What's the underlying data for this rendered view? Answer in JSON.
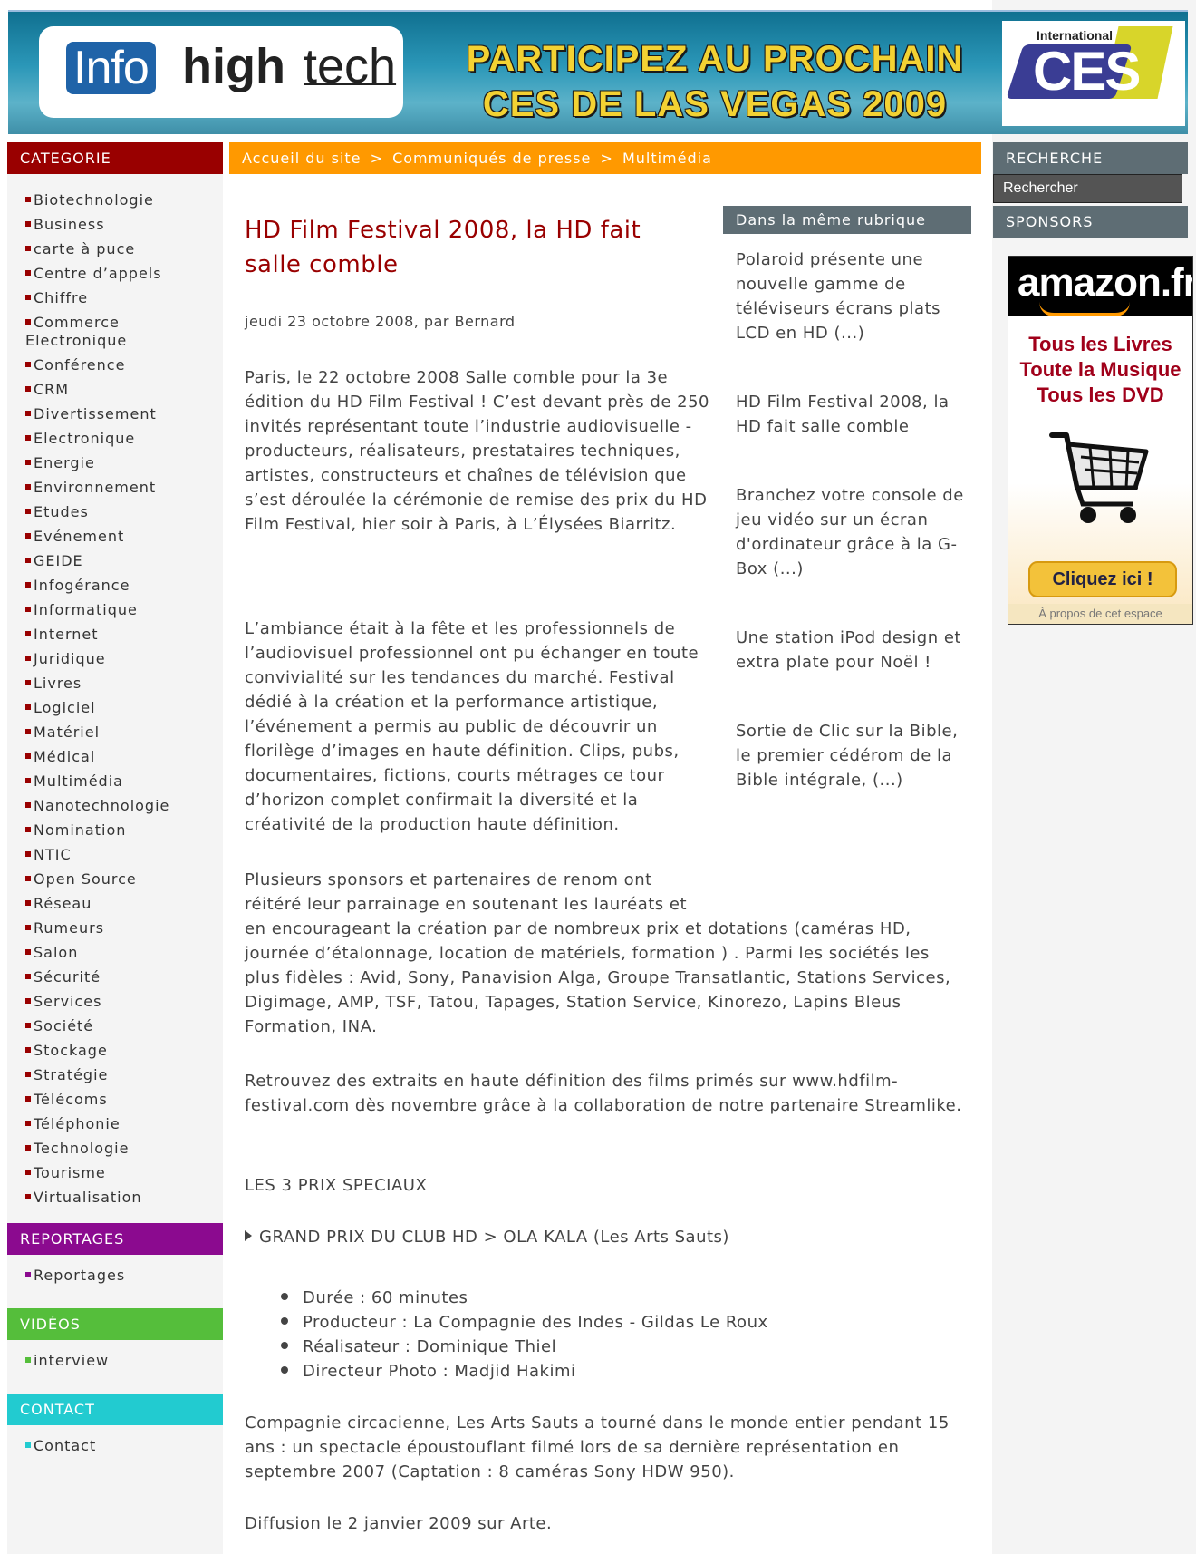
{
  "banner": {
    "logo_info": "Info",
    "logo_high": "high",
    "logo_tech": "tech",
    "promo_line1": "PARTICIPEZ AU PROCHAIN",
    "promo_line2": "CES DE LAS VEGAS 2009",
    "ces_international": "International",
    "ces_logo": "CES"
  },
  "sidebar_left": {
    "categorie_title": "CATEGORIE",
    "categories": [
      "Biotechnologie",
      "Business",
      "carte à puce",
      "Centre d’appels",
      "Chiffre",
      "Commerce Electronique",
      "Conférence",
      "CRM",
      "Divertissement",
      "Electronique",
      "Energie",
      "Environnement",
      "Etudes",
      "Evénement",
      "GEIDE",
      "Infogérance",
      "Informatique",
      "Internet",
      "Juridique",
      "Livres",
      "Logiciel",
      "Matériel",
      "Médical",
      "Multimédia",
      "Nanotechnologie",
      "Nomination",
      "NTIC",
      "Open Source",
      "Réseau",
      "Rumeurs",
      "Salon",
      "Sécurité",
      "Services",
      "Société",
      "Stockage",
      "Stratégie",
      "Télécoms",
      "Téléphonie",
      "Technologie",
      "Tourisme",
      "Virtualisation"
    ],
    "reportages_title": "REPORTAGES",
    "reportages_item": "Reportages",
    "videos_title": "VIDÉOS",
    "videos_item": "interview",
    "contact_title": "CONTACT",
    "contact_item": "Contact"
  },
  "breadcrumb": {
    "home": "Accueil du site",
    "section": "Communiqués de presse",
    "subsection": "Multimédia",
    "separator": ">"
  },
  "article": {
    "title": "HD Film Festival 2008, la HD fait salle comble",
    "byline": "jeudi 23 octobre 2008, par Bernard",
    "p1": "Paris, le 22 octobre 2008 Salle comble pour la 3e édition du HD Film Festival ! C’est devant près de 250 invités représentant toute l’industrie audiovisuelle - producteurs, réalisateurs, prestataires techniques, artistes, constructeurs et chaînes de télévision que s’est déroulée la cérémonie de remise des prix du HD Film Festival, hier soir à Paris, à L’Élysées Biarritz.",
    "p2": "L’ambiance était à la fête et les professionnels de l’audiovisuel professionnel ont pu échanger en toute convivialité sur les tendances du marché. Festival dédié à la création et la performance artistique, l’événement a permis au public de découvrir un florilège d’images en haute définition. Clips, pubs, documentaires, fictions, courts métrages ce tour d’horizon complet confirmait la diversité et la créativité de la production haute définition.",
    "p3_start": "Plusieurs sponsors et partenaires de renom ont réitéré leur parrainage en soutenant les lauréats et",
    "p3_end": "en encourageant la création par de nombreux prix et dotations (caméras HD, journée d’étalonnage, location de matériels, formation ) . Parmi les sociétés les plus fidèles : Avid, Sony, Panavision Alga, Groupe Transatlantic, Stations Services, Digimage, AMP, TSF, Tatou, Tapages, Station Service, Kinorezo, Lapins Bleus Formation, INA.",
    "p4": "Retrouvez des extraits en haute définition des films primés sur www.hdfilm-festival.com dès novembre grâce à la collaboration de notre partenaire Streamlike.",
    "p5": "LES 3 PRIX SPECIAUX",
    "prize": "GRAND PRIX DU CLUB HD > OLA KALA (Les Arts Sauts)",
    "details": [
      "Durée : 60 minutes",
      "Producteur : La Compagnie des Indes - Gildas Le Roux",
      "Réalisateur : Dominique Thiel",
      "Directeur Photo : Madjid Hakimi"
    ],
    "p6": "Compagnie circacienne, Les Arts Sauts a tourné dans le monde entier pendant 15 ans : un spectacle époustouflant filmé lors de sa dernière représentation en septembre 2007 (Captation : 8 caméras Sony HDW 950).",
    "p7": "Diffusion le 2 janvier 2009 sur Arte."
  },
  "same_rubrique": {
    "title": "Dans la même rubrique",
    "items": [
      "Polaroid présente une nouvelle gamme de téléviseurs écrans plats LCD en HD (...)",
      "HD Film Festival 2008, la HD fait salle comble",
      "Branchez votre console de jeu vidéo sur un écran d'ordinateur grâce à la G-Box (...)",
      "Une station iPod design et extra plate pour Noël !",
      "Sortie de Clic sur la Bible, le premier cédérom de la Bible intégrale, (...)"
    ]
  },
  "sidebar_right": {
    "recherche_title": "RECHERCHE",
    "search_placeholder": "Rechercher",
    "sponsors_title": "SPONSORS"
  },
  "ad": {
    "logo": "amazon.fr",
    "line1": "Tous les Livres",
    "line2": "Toute la Musique",
    "line3": "Tous les DVD",
    "button": "Cliquez ici !",
    "footer": "À propos de cet espace"
  }
}
